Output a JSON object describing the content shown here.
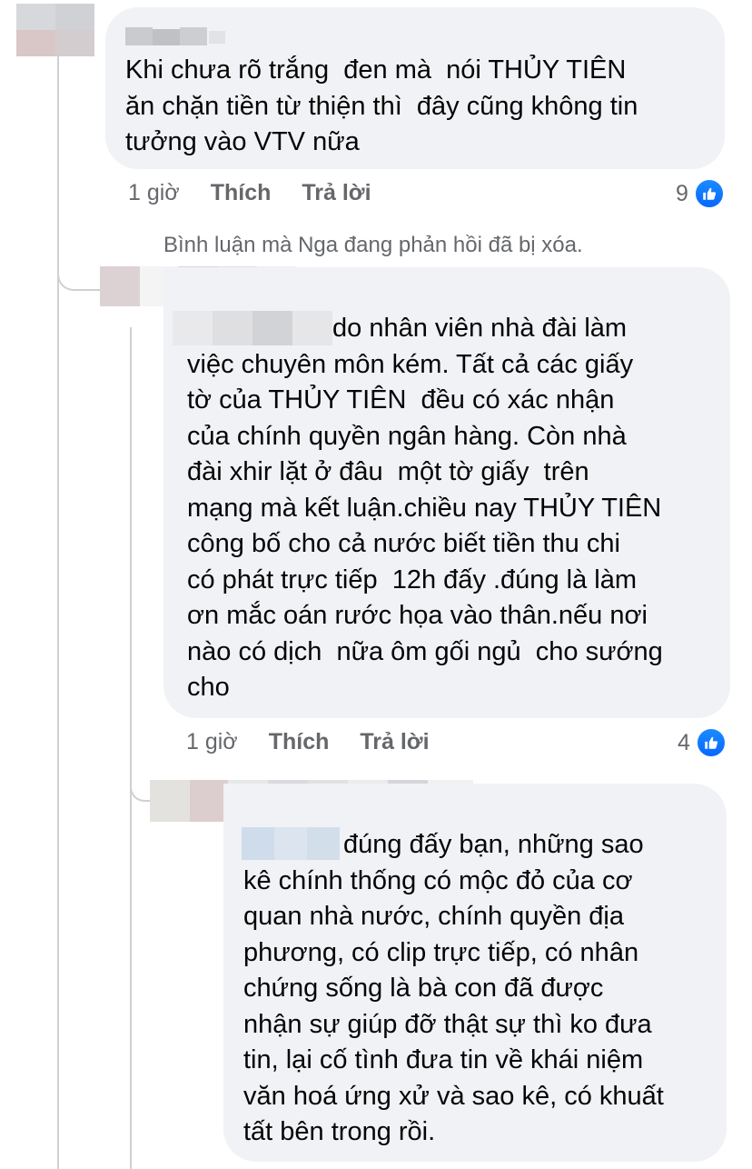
{
  "comments": [
    {
      "text": "Khi chưa rõ trắng  đen mà  nói THỦY TIÊN\năn chặn tiền từ thiện thì  đây cũng không tin\ntưởng vào VTV nữa",
      "time": "1 giờ",
      "like": "Thích",
      "reply": "Trả lời",
      "reactions": "9"
    },
    {
      "text": "do nhân viên nhà đài làm\nviệc chuyên môn kém. Tất cả các giấy\ntờ của THỦY TIÊN  đều có xác nhận\ncủa chính quyền ngân hàng. Còn nhà\nđài xhir lặt ở đâu  một tờ giấy  trên\nmạng mà kết luận.chiều nay THỦY TIÊN\ncông bố cho cả nước biết tiền thu chi\ncó phát trực tiếp  12h đấy .đúng là làm\nơn mắc oán rước họa vào thân.nếu nơi\nnào có dịch  nữa ôm gối ngủ  cho sướng\ncho",
      "time": "1 giờ",
      "like": "Thích",
      "reply": "Trả lời",
      "reactions": "4"
    },
    {
      "text": "đúng đấy bạn, những sao\nkê chính thống có mộc đỏ của cơ\nquan nhà nước, chính quyền địa\nphương, có clip trực tiếp, có nhân\nchứng sống là bà con đã được\nnhận sự giúp đỡ thật sự thì ko đưa\ntin, lại cố tình đưa tin về khái niệm\nvăn hoá ứng xử và sao kê, có khuất\ntất bên trong rồi."
    }
  ],
  "deleted_notice": "Bình luận mà Nga đang phản hồi đã bị xóa.",
  "icons": {
    "reaction": "like-thumb-icon"
  },
  "colors": {
    "bubble": "#f0f2f5",
    "meta": "#65676b",
    "like_blue": "#0866ff",
    "thread_line": "#ced0d4"
  }
}
